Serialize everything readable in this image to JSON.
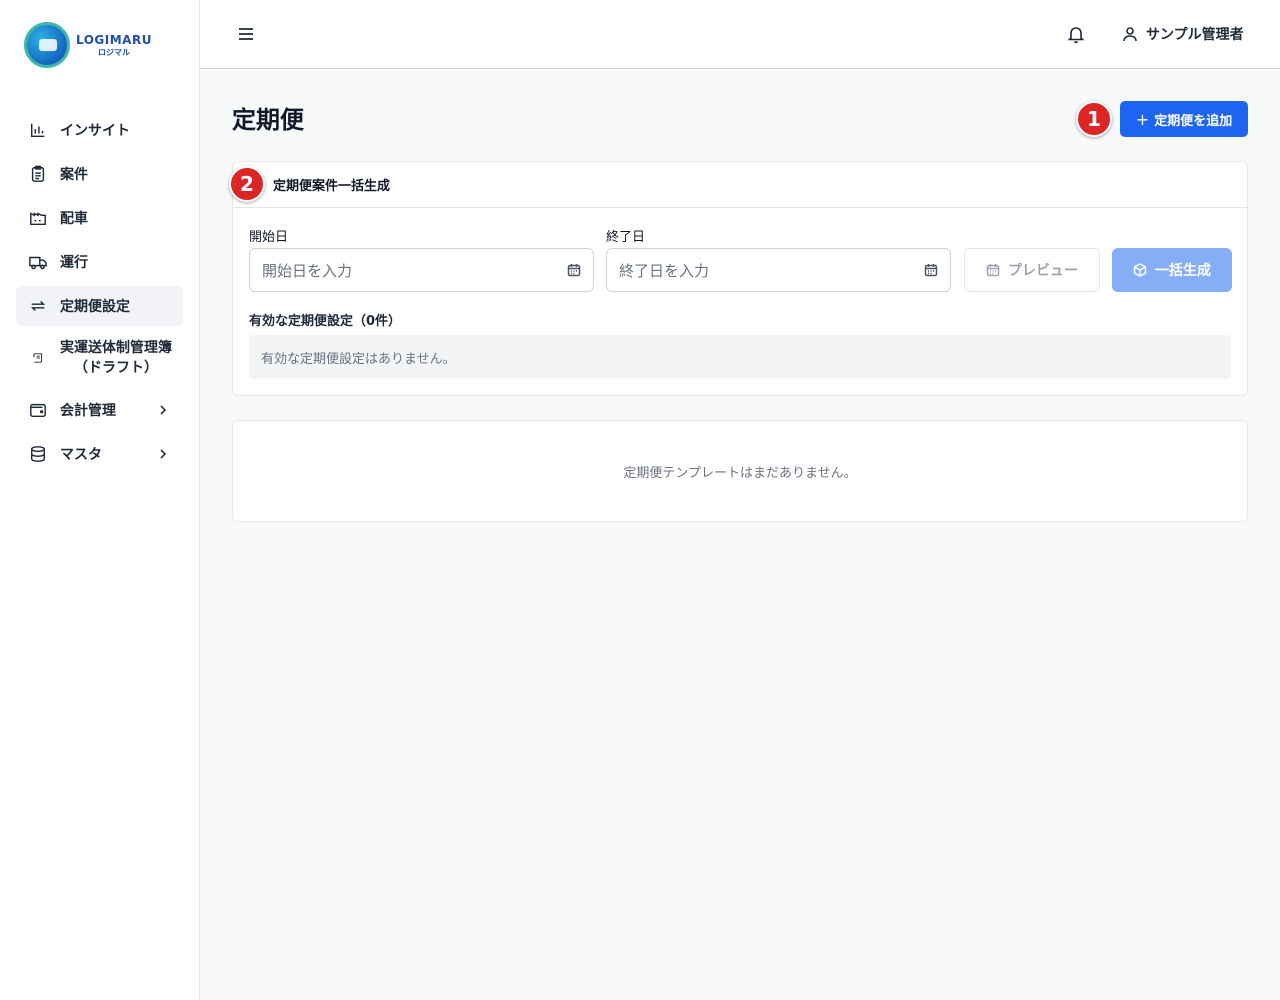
{
  "brand": {
    "name": "LOGIMARU",
    "sub": "ロジマル"
  },
  "sidebar": {
    "items": [
      {
        "label": "インサイト",
        "icon": "bar-chart-icon"
      },
      {
        "label": "案件",
        "icon": "clipboard-icon"
      },
      {
        "label": "配車",
        "icon": "factory-icon"
      },
      {
        "label": "運行",
        "icon": "truck-icon"
      },
      {
        "label": "定期便設定",
        "icon": "repeat-icon",
        "active": true
      },
      {
        "label_line1": "実運送体制管理簿",
        "label_line2": "（ドラフト）",
        "icon": "scroll-icon"
      },
      {
        "label": "会計管理",
        "icon": "wallet-icon",
        "expandable": true
      },
      {
        "label": "マスタ",
        "icon": "database-icon",
        "expandable": true
      }
    ]
  },
  "header": {
    "user_name": "サンプル管理者"
  },
  "page": {
    "title": "定期便",
    "add_button_label": "定期便を追加",
    "badge1": "1",
    "badge2": "2"
  },
  "bulk": {
    "title": "定期便案件一括生成",
    "start_label": "開始日",
    "start_placeholder": "開始日を入力",
    "end_label": "終了日",
    "end_placeholder": "終了日を入力",
    "preview_label": "プレビュー",
    "generate_label": "一括生成",
    "active_title": "有効な定期便設定（0件）",
    "active_empty": "有効な定期便設定はありません。"
  },
  "templates": {
    "empty": "定期便テンプレートはまだありません。"
  },
  "colors": {
    "primary": "#1d64f0",
    "primary_disabled": "#86aef7",
    "badge": "#dc2626"
  }
}
